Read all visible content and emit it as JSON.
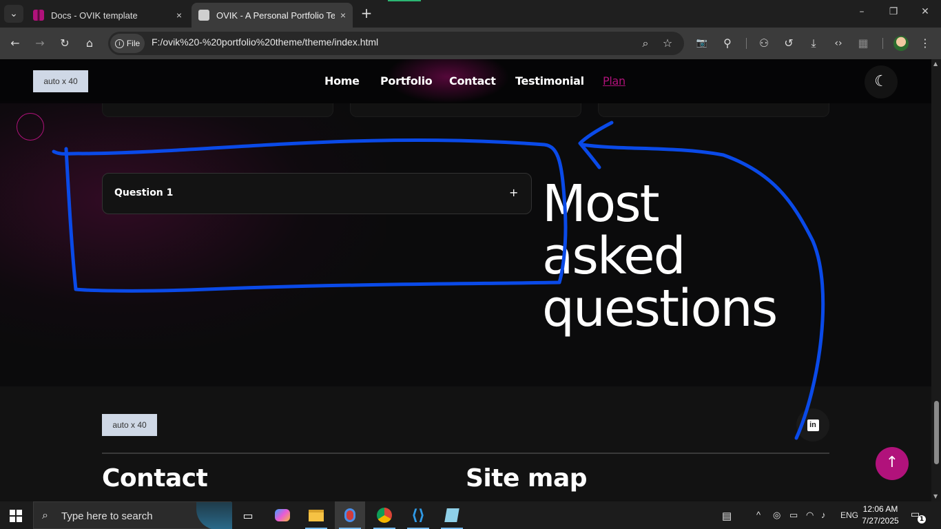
{
  "browser": {
    "tab_list_icon": "chevron-down-icon",
    "tabs": [
      {
        "title": "Docs - OVIK template",
        "close": "×"
      },
      {
        "title": "OVIK - A Personal Portfolio Tem",
        "close": "×"
      }
    ],
    "new_tab": "+",
    "window_controls": {
      "minimize": "–",
      "restore": "❐",
      "close": "✕"
    },
    "nav": {
      "back": "←",
      "forward": "→",
      "reload": "↻",
      "home": "⌂"
    },
    "site_info_label": "File",
    "url": "F:/ovik%20-%20portfolio%20theme/theme/index.html",
    "omnibox_icons": {
      "zoom": "⌕",
      "bookmark": "☆"
    },
    "toolbar_icons": {
      "camera": "📷",
      "extensions": "⚲",
      "incognito": "⚇",
      "history": "↺",
      "download": "⤓",
      "devtools": "‹›",
      "qr": "▦",
      "menu": "⋮"
    }
  },
  "site": {
    "logo_placeholder": "auto x 40",
    "nav": [
      "Home",
      "Portfolio",
      "Contact",
      "Testimonial",
      "Plan"
    ],
    "active_nav": "Plan",
    "theme_toggle_icon": "☾",
    "accent_color": "#b1127b",
    "faq": {
      "items": [
        {
          "question": "Question 1",
          "toggle": "+"
        }
      ],
      "title_lines": [
        "Most",
        "asked",
        "questions"
      ]
    },
    "footer": {
      "logo_placeholder": "auto x 40",
      "social_icon": "in",
      "headings": [
        "Contact",
        "Site map"
      ]
    },
    "back_to_top_icon": "↑"
  },
  "taskbar": {
    "search_placeholder": "Type here to search",
    "apps": [
      "task-view",
      "copilot",
      "file-explorer",
      "app-active",
      "chrome",
      "vscode",
      "notepad"
    ],
    "tray": {
      "chevron": "^",
      "language": "ENG"
    },
    "time": "12:06 AM",
    "date": "7/27/2025",
    "notifications": "1"
  }
}
